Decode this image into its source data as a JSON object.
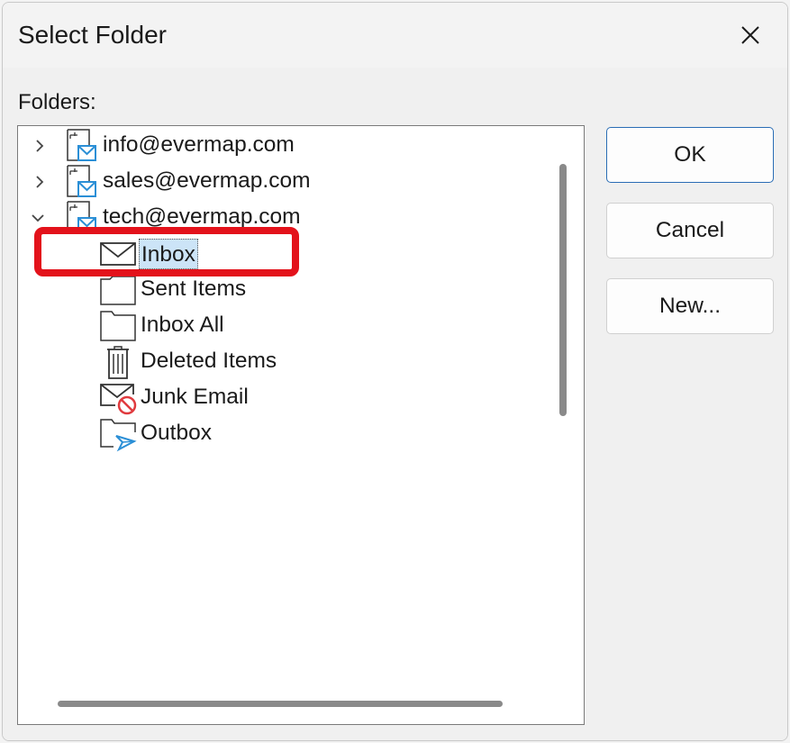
{
  "dialog": {
    "title": "Select Folder",
    "folders_label": "Folders:"
  },
  "tree": {
    "accounts": [
      {
        "label": "info@evermap.com",
        "expanded": false
      },
      {
        "label": "sales@evermap.com",
        "expanded": false
      },
      {
        "label": "tech@evermap.com",
        "expanded": true
      }
    ],
    "subfolders": [
      {
        "label": "Inbox",
        "icon": "envelope-icon",
        "selected": true
      },
      {
        "label": "Sent Items",
        "icon": "folder-icon"
      },
      {
        "label": "Inbox All",
        "icon": "folder-icon"
      },
      {
        "label": "Deleted Items",
        "icon": "trash-icon"
      },
      {
        "label": "Junk Email",
        "icon": "junk-mail-icon"
      },
      {
        "label": "Outbox",
        "icon": "outbox-icon"
      }
    ]
  },
  "buttons": {
    "ok": "OK",
    "cancel": "Cancel",
    "new": "New..."
  },
  "colors": {
    "accent": "#2a6db5",
    "selection": "#cce4f7",
    "highlight_annotation": "#e3121b",
    "mail_blue": "#2b8fd6",
    "junk_red": "#e03a3e"
  }
}
